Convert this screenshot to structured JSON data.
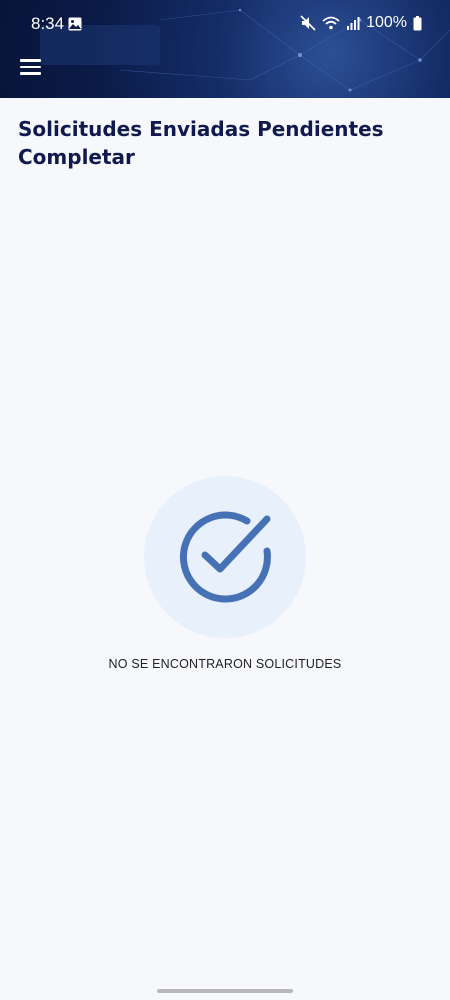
{
  "status_bar": {
    "time": "8:34",
    "battery": "100%",
    "icons": [
      "gallery-icon",
      "mute-icon",
      "wifi-icon",
      "signal-icon",
      "battery-icon"
    ]
  },
  "header": {
    "menu_icon": "hamburger-menu-icon",
    "background": "#0b1b47"
  },
  "page": {
    "title": "Solicitudes Enviadas Pendientes Completar"
  },
  "empty_state": {
    "icon": "check-circle-icon",
    "message": "NO SE ENCONTRARON SOLICITUDES",
    "accent_color": "#4672b5"
  }
}
